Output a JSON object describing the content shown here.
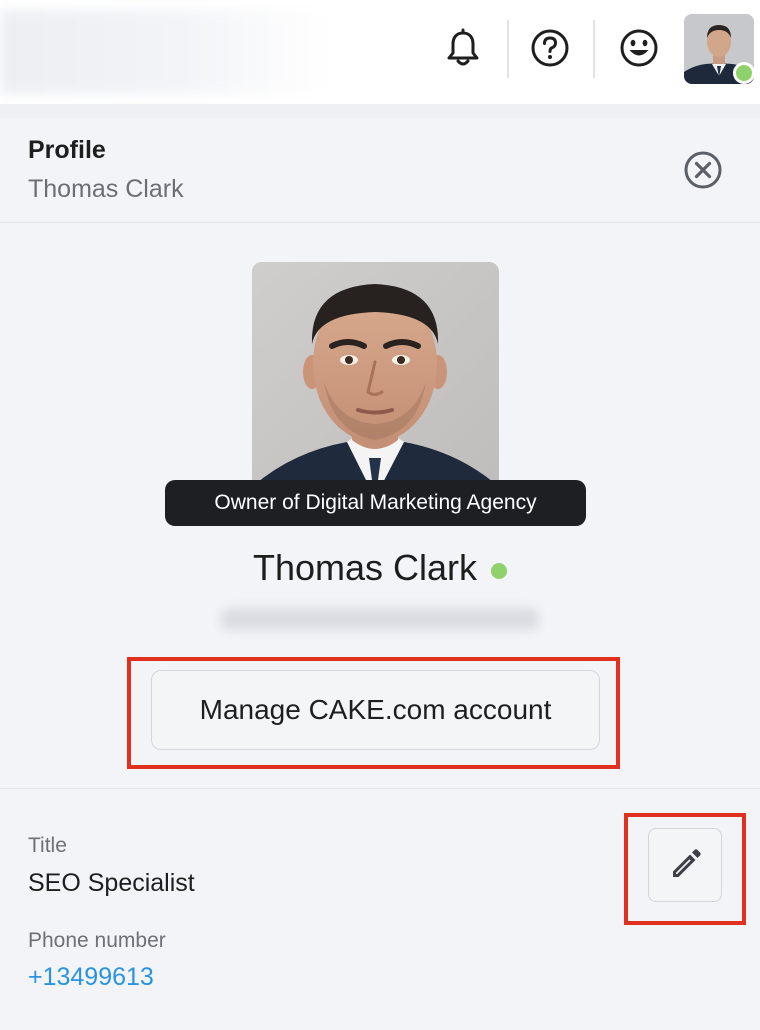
{
  "profile_panel": {
    "title": "Profile",
    "subtitle": "Thomas Clark",
    "tooltip": "Owner of Digital Marketing Agency",
    "name": "Thomas Clark",
    "manage_button_label": "Manage CAKE.com account",
    "fields": {
      "title_label": "Title",
      "title_value": "SEO Specialist",
      "phone_label": "Phone number",
      "phone_value": "+13499613"
    }
  },
  "icons": {
    "notifications": "bell-icon",
    "help": "question-circle-icon",
    "emoji": "smiley-icon",
    "close": "close-circle-icon",
    "edit": "pencil-icon"
  },
  "colors": {
    "online_status": "#8fd16a",
    "link": "#2a93e0",
    "highlight": "#e1301e",
    "tooltip_bg": "#1d1f22"
  }
}
